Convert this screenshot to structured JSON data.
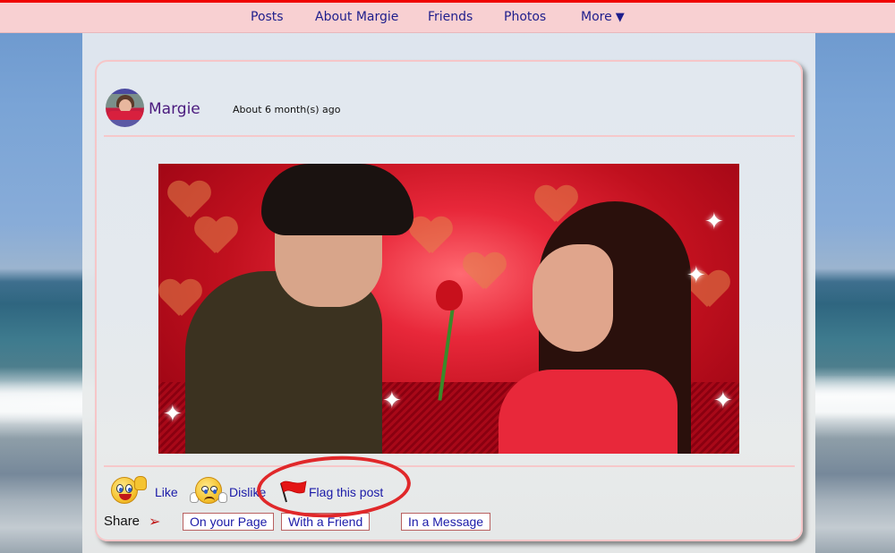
{
  "nav": {
    "items": [
      {
        "label": "Posts"
      },
      {
        "label": "About Margie"
      },
      {
        "label": "Friends"
      },
      {
        "label": "Photos"
      },
      {
        "label": "More",
        "icon": "caret-down-icon",
        "glyph": "▼"
      }
    ]
  },
  "post": {
    "author": "Margie",
    "timestamp": "About 6 month(s) ago",
    "image_alt": "Couple holding a red rose on a red hearts background",
    "actions": {
      "like": "Like",
      "dislike": "Dislike",
      "flag": "Flag this post"
    },
    "share": {
      "label": "Share",
      "arrow_glyph": "➢",
      "buttons": [
        "On your Page",
        "With a Friend",
        "In a Message"
      ]
    }
  },
  "colors": {
    "topbar_border": "#f00000",
    "topbar_bg": "#f8d0d2",
    "link": "#1a1aa8",
    "author": "#4a1a7e",
    "highlight_ring": "#e0282a"
  }
}
